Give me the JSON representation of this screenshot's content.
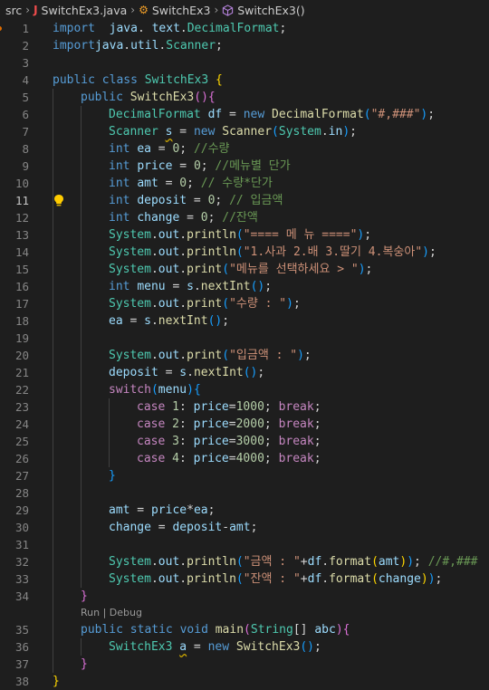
{
  "breadcrumb": {
    "folder": "src",
    "file": "SwitchEx3.java",
    "class_name": "SwitchEx3",
    "method": "SwitchEx3()"
  },
  "codelens": "Run | Debug",
  "lines": [
    {
      "n": "1",
      "t": [
        [
          "kw",
          "import"
        ],
        [
          "",
          "  "
        ],
        [
          "var",
          "java"
        ],
        [
          "",
          ". "
        ],
        [
          "var",
          "text"
        ],
        [
          "",
          "."
        ],
        [
          "ty",
          "DecimalFormat"
        ],
        [
          "",
          ";"
        ]
      ]
    },
    {
      "n": "2",
      "t": [
        [
          "kw",
          "import"
        ],
        [
          "",
          ""
        ],
        [
          "var",
          "java"
        ],
        [
          "",
          "."
        ],
        [
          "var",
          "util"
        ],
        [
          "",
          "."
        ],
        [
          "ty",
          "Scanner"
        ],
        [
          "",
          ";"
        ]
      ]
    },
    {
      "n": "3",
      "t": []
    },
    {
      "n": "4",
      "t": [
        [
          "kw",
          "public"
        ],
        [
          "",
          " "
        ],
        [
          "kw",
          "class"
        ],
        [
          "",
          " "
        ],
        [
          "ty",
          "SwitchEx3"
        ],
        [
          "",
          " "
        ],
        [
          "br1",
          "{"
        ]
      ]
    },
    {
      "n": "5",
      "t": [
        [
          "",
          ""
        ],
        [
          "kw",
          "public"
        ],
        [
          "",
          " "
        ],
        [
          "fn",
          "SwitchEx3"
        ],
        [
          "br2",
          "()"
        ],
        [
          "br2",
          "{"
        ]
      ]
    },
    {
      "n": "6",
      "t": [
        [
          "ty",
          "DecimalFormat"
        ],
        [
          "",
          " "
        ],
        [
          "var",
          "df"
        ],
        [
          "",
          " = "
        ],
        [
          "kw",
          "new"
        ],
        [
          "",
          " "
        ],
        [
          "fn",
          "DecimalFormat"
        ],
        [
          "br3",
          "("
        ],
        [
          "str",
          "\"#,###\""
        ],
        [
          "br3",
          ")"
        ],
        [
          "",
          ";"
        ]
      ]
    },
    {
      "n": "7",
      "t": [
        [
          "ty",
          "Scanner"
        ],
        [
          "",
          " "
        ],
        [
          "var sq",
          "s"
        ],
        [
          "",
          " = "
        ],
        [
          "kw",
          "new"
        ],
        [
          "",
          " "
        ],
        [
          "fn",
          "Scanner"
        ],
        [
          "br3",
          "("
        ],
        [
          "ty",
          "System"
        ],
        [
          "",
          "."
        ],
        [
          "var",
          "in"
        ],
        [
          "br3",
          ")"
        ],
        [
          "",
          ";"
        ]
      ]
    },
    {
      "n": "8",
      "t": [
        [
          "kw",
          "int"
        ],
        [
          "",
          " "
        ],
        [
          "var",
          "ea"
        ],
        [
          "",
          " = "
        ],
        [
          "num",
          "0"
        ],
        [
          "",
          "; "
        ],
        [
          "cm",
          "//수량"
        ]
      ]
    },
    {
      "n": "9",
      "t": [
        [
          "kw",
          "int"
        ],
        [
          "",
          " "
        ],
        [
          "var",
          "price"
        ],
        [
          "",
          " = "
        ],
        [
          "num",
          "0"
        ],
        [
          "",
          "; "
        ],
        [
          "cm",
          "//메뉴별 단가"
        ]
      ]
    },
    {
      "n": "10",
      "t": [
        [
          "kw",
          "int"
        ],
        [
          "",
          " "
        ],
        [
          "var",
          "amt"
        ],
        [
          "",
          " = "
        ],
        [
          "num",
          "0"
        ],
        [
          "",
          "; "
        ],
        [
          "cm",
          "// 수량*단가"
        ]
      ]
    },
    {
      "n": "11",
      "t": [
        [
          "kw",
          "int"
        ],
        [
          "",
          " "
        ],
        [
          "var",
          "deposit"
        ],
        [
          "",
          " = "
        ],
        [
          "num",
          "0"
        ],
        [
          "",
          "; "
        ],
        [
          "cm",
          "// 입금액"
        ]
      ]
    },
    {
      "n": "12",
      "t": [
        [
          "kw",
          "int"
        ],
        [
          "",
          " "
        ],
        [
          "var",
          "change"
        ],
        [
          "",
          " = "
        ],
        [
          "num",
          "0"
        ],
        [
          "",
          "; "
        ],
        [
          "cm",
          "//잔액"
        ]
      ]
    },
    {
      "n": "13",
      "t": [
        [
          "ty",
          "System"
        ],
        [
          "",
          "."
        ],
        [
          "var",
          "out"
        ],
        [
          "",
          "."
        ],
        [
          "fn",
          "println"
        ],
        [
          "br3",
          "("
        ],
        [
          "str",
          "\"==== 메 뉴 ====\""
        ],
        [
          "br3",
          ")"
        ],
        [
          "",
          ";"
        ]
      ]
    },
    {
      "n": "14",
      "t": [
        [
          "ty",
          "System"
        ],
        [
          "",
          "."
        ],
        [
          "var",
          "out"
        ],
        [
          "",
          "."
        ],
        [
          "fn",
          "println"
        ],
        [
          "br3",
          "("
        ],
        [
          "str",
          "\"1.사과 2.배 3.딸기 4.복숭아\""
        ],
        [
          "br3",
          ")"
        ],
        [
          "",
          ";"
        ]
      ]
    },
    {
      "n": "15",
      "t": [
        [
          "ty",
          "System"
        ],
        [
          "",
          "."
        ],
        [
          "var",
          "out"
        ],
        [
          "",
          "."
        ],
        [
          "fn",
          "print"
        ],
        [
          "br3",
          "("
        ],
        [
          "str",
          "\"메뉴를 선택하세요 > \""
        ],
        [
          "br3",
          ")"
        ],
        [
          "",
          ";"
        ]
      ]
    },
    {
      "n": "16",
      "t": [
        [
          "kw",
          "int"
        ],
        [
          "",
          " "
        ],
        [
          "var",
          "menu"
        ],
        [
          "",
          " = "
        ],
        [
          "var",
          "s"
        ],
        [
          "",
          "."
        ],
        [
          "fn",
          "nextInt"
        ],
        [
          "br3",
          "()"
        ],
        [
          "",
          ";"
        ]
      ]
    },
    {
      "n": "17",
      "t": [
        [
          "ty",
          "System"
        ],
        [
          "",
          "."
        ],
        [
          "var",
          "out"
        ],
        [
          "",
          "."
        ],
        [
          "fn",
          "print"
        ],
        [
          "br3",
          "("
        ],
        [
          "str",
          "\"수량 : \""
        ],
        [
          "br3",
          ")"
        ],
        [
          "",
          ";"
        ]
      ]
    },
    {
      "n": "18",
      "t": [
        [
          "var",
          "ea"
        ],
        [
          "",
          " = "
        ],
        [
          "var",
          "s"
        ],
        [
          "",
          "."
        ],
        [
          "fn",
          "nextInt"
        ],
        [
          "br3",
          "()"
        ],
        [
          "",
          ";"
        ]
      ]
    },
    {
      "n": "19",
      "t": []
    },
    {
      "n": "20",
      "t": [
        [
          "ty",
          "System"
        ],
        [
          "",
          "."
        ],
        [
          "var",
          "out"
        ],
        [
          "",
          "."
        ],
        [
          "fn",
          "print"
        ],
        [
          "br3",
          "("
        ],
        [
          "str",
          "\"입금액 : \""
        ],
        [
          "br3",
          ")"
        ],
        [
          "",
          ";"
        ]
      ]
    },
    {
      "n": "21",
      "t": [
        [
          "var",
          "deposit"
        ],
        [
          "",
          " = "
        ],
        [
          "var",
          "s"
        ],
        [
          "",
          "."
        ],
        [
          "fn",
          "nextInt"
        ],
        [
          "br3",
          "()"
        ],
        [
          "",
          ";"
        ]
      ]
    },
    {
      "n": "22",
      "t": [
        [
          "ctl",
          "switch"
        ],
        [
          "br3",
          "("
        ],
        [
          "var",
          "menu"
        ],
        [
          "br3",
          ")"
        ],
        [
          "br3",
          "{"
        ]
      ]
    },
    {
      "n": "23",
      "t": [
        [
          "ctl",
          "case"
        ],
        [
          "",
          " "
        ],
        [
          "num",
          "1"
        ],
        [
          "",
          ": "
        ],
        [
          "var",
          "price"
        ],
        [
          "",
          "="
        ],
        [
          "num",
          "1000"
        ],
        [
          "",
          "; "
        ],
        [
          "ctl",
          "break"
        ],
        [
          "",
          ";"
        ]
      ]
    },
    {
      "n": "24",
      "t": [
        [
          "ctl",
          "case"
        ],
        [
          "",
          " "
        ],
        [
          "num",
          "2"
        ],
        [
          "",
          ": "
        ],
        [
          "var",
          "price"
        ],
        [
          "",
          "="
        ],
        [
          "num",
          "2000"
        ],
        [
          "",
          "; "
        ],
        [
          "ctl",
          "break"
        ],
        [
          "",
          ";"
        ]
      ]
    },
    {
      "n": "25",
      "t": [
        [
          "ctl",
          "case"
        ],
        [
          "",
          " "
        ],
        [
          "num",
          "3"
        ],
        [
          "",
          ": "
        ],
        [
          "var",
          "price"
        ],
        [
          "",
          "="
        ],
        [
          "num",
          "3000"
        ],
        [
          "",
          "; "
        ],
        [
          "ctl",
          "break"
        ],
        [
          "",
          ";"
        ]
      ]
    },
    {
      "n": "26",
      "t": [
        [
          "ctl",
          "case"
        ],
        [
          "",
          " "
        ],
        [
          "num",
          "4"
        ],
        [
          "",
          ": "
        ],
        [
          "var",
          "price"
        ],
        [
          "",
          "="
        ],
        [
          "num",
          "4000"
        ],
        [
          "",
          "; "
        ],
        [
          "ctl",
          "break"
        ],
        [
          "",
          ";"
        ]
      ]
    },
    {
      "n": "27",
      "t": [
        [
          "br3",
          "}"
        ]
      ]
    },
    {
      "n": "28",
      "t": []
    },
    {
      "n": "29",
      "t": [
        [
          "var",
          "amt"
        ],
        [
          "",
          " = "
        ],
        [
          "var",
          "price"
        ],
        [
          "",
          "*"
        ],
        [
          "var",
          "ea"
        ],
        [
          "",
          ";"
        ]
      ]
    },
    {
      "n": "30",
      "t": [
        [
          "var",
          "change"
        ],
        [
          "",
          " = "
        ],
        [
          "var",
          "deposit"
        ],
        [
          "",
          "-"
        ],
        [
          "var",
          "amt"
        ],
        [
          "",
          ";"
        ]
      ]
    },
    {
      "n": "31",
      "t": []
    },
    {
      "n": "32",
      "t": [
        [
          "ty",
          "System"
        ],
        [
          "",
          "."
        ],
        [
          "var",
          "out"
        ],
        [
          "",
          "."
        ],
        [
          "fn",
          "println"
        ],
        [
          "br3",
          "("
        ],
        [
          "str",
          "\"금액 : \""
        ],
        [
          "",
          "+"
        ],
        [
          "var",
          "df"
        ],
        [
          "",
          "."
        ],
        [
          "fn",
          "format"
        ],
        [
          "br1",
          "("
        ],
        [
          "var",
          "amt"
        ],
        [
          "br1",
          ")"
        ],
        [
          "br3",
          ")"
        ],
        [
          "",
          "; "
        ],
        [
          "cm",
          "//#,###"
        ]
      ]
    },
    {
      "n": "33",
      "t": [
        [
          "ty",
          "System"
        ],
        [
          "",
          "."
        ],
        [
          "var",
          "out"
        ],
        [
          "",
          "."
        ],
        [
          "fn",
          "println"
        ],
        [
          "br3",
          "("
        ],
        [
          "str",
          "\"잔액 : \""
        ],
        [
          "",
          "+"
        ],
        [
          "var",
          "df"
        ],
        [
          "",
          "."
        ],
        [
          "fn",
          "format"
        ],
        [
          "br1",
          "("
        ],
        [
          "var",
          "change"
        ],
        [
          "br1",
          ")"
        ],
        [
          "br3",
          ")"
        ],
        [
          "",
          ";"
        ]
      ]
    },
    {
      "n": "34",
      "t": [
        [
          "br2",
          "}"
        ]
      ]
    },
    {
      "n": "35",
      "t": [
        [
          "kw",
          "public"
        ],
        [
          "",
          " "
        ],
        [
          "kw",
          "static"
        ],
        [
          "",
          " "
        ],
        [
          "kw",
          "void"
        ],
        [
          "",
          " "
        ],
        [
          "fn",
          "main"
        ],
        [
          "br2",
          "("
        ],
        [
          "ty",
          "String"
        ],
        [
          "",
          "[] "
        ],
        [
          "var",
          "abc"
        ],
        [
          "br2",
          ")"
        ],
        [
          "br2",
          "{"
        ]
      ]
    },
    {
      "n": "36",
      "t": [
        [
          "ty",
          "SwitchEx3"
        ],
        [
          "",
          " "
        ],
        [
          "var sq",
          "a"
        ],
        [
          "",
          " = "
        ],
        [
          "kw",
          "new"
        ],
        [
          "",
          " "
        ],
        [
          "fn",
          "SwitchEx3"
        ],
        [
          "br3",
          "()"
        ],
        [
          "",
          ";"
        ]
      ]
    },
    {
      "n": "37",
      "t": [
        [
          "br2",
          "}"
        ]
      ]
    },
    {
      "n": "38",
      "t": [
        [
          "br1",
          "}"
        ]
      ]
    }
  ]
}
